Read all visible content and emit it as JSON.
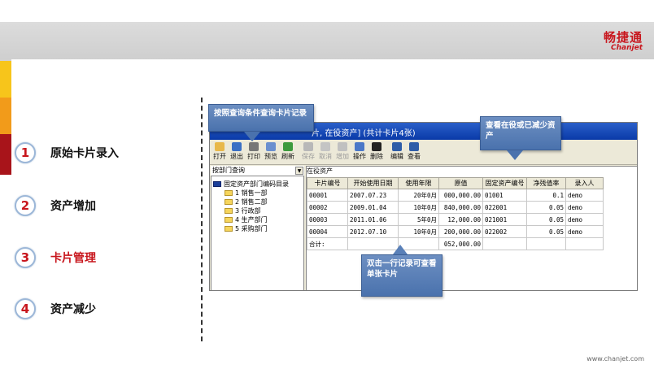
{
  "logo": {
    "cn": "畅捷通",
    "en": "Chanjet"
  },
  "accent_colors": {
    "red": "#c8161d",
    "orange": "#f29b1a",
    "yellow": "#f7c51b",
    "dark_red": "#a8141a"
  },
  "menu": [
    {
      "num": "1",
      "label": "原始卡片录入"
    },
    {
      "num": "2",
      "label": "资产增加"
    },
    {
      "num": "3",
      "label": "卡片管理"
    },
    {
      "num": "4",
      "label": "资产减少"
    }
  ],
  "active_menu": "卡片管理",
  "footer_url": "www.chanjet.com",
  "app": {
    "title": "片, 在役资产] (共计卡片4张)",
    "toolbar": [
      {
        "label": "打开",
        "icon": "open-icon"
      },
      {
        "label": "退出",
        "icon": "exit-icon"
      },
      {
        "label": "打印",
        "icon": "print-icon"
      },
      {
        "label": "预览",
        "icon": "preview-icon"
      },
      {
        "label": "刷新",
        "icon": "refresh-icon"
      },
      {
        "label": "保存",
        "icon": "save-icon",
        "disabled": true
      },
      {
        "label": "取消",
        "icon": "cancel-icon",
        "disabled": true
      },
      {
        "label": "增加",
        "icon": "add-icon",
        "disabled": true
      },
      {
        "label": "操作",
        "icon": "operate-icon"
      },
      {
        "label": "删除",
        "icon": "delete-icon"
      },
      {
        "label": "编辑",
        "icon": "edit-icon"
      },
      {
        "label": "查看",
        "icon": "view-icon"
      }
    ],
    "query_combo": "按部门查询",
    "tree_root": "固定资产部门编码目录",
    "tree_items": [
      "1 销售一部",
      "2 销售二部",
      "3 行政部",
      "4 生产部门",
      "5 采购部门"
    ],
    "state_label": "在役资产",
    "columns": [
      "卡片编号",
      "开始使用日期",
      "使用年限",
      "原值",
      "固定资产编号",
      "净残值率",
      "录入人"
    ],
    "rows": [
      [
        "00001",
        "2007.07.23",
        "20年0月",
        "000,000.00",
        "01001",
        "0.1",
        "demo"
      ],
      [
        "00002",
        "2009.01.04",
        "10年0月",
        "840,000.00",
        "022001",
        "0.05",
        "demo"
      ],
      [
        "00003",
        "2011.01.06",
        "5年0月",
        "12,000.00",
        "021001",
        "0.05",
        "demo"
      ],
      [
        "00004",
        "2012.07.10",
        "10年0月",
        "200,000.00",
        "022002",
        "0.05",
        "demo"
      ]
    ],
    "total_row": [
      "合计:",
      "",
      "",
      "052,000.00",
      "",
      "",
      ""
    ]
  },
  "callouts": {
    "query": "按照查询条件查询卡片记录",
    "view": "查看在役或已减少资产",
    "detail": "双击一行记录可查看单张卡片"
  }
}
